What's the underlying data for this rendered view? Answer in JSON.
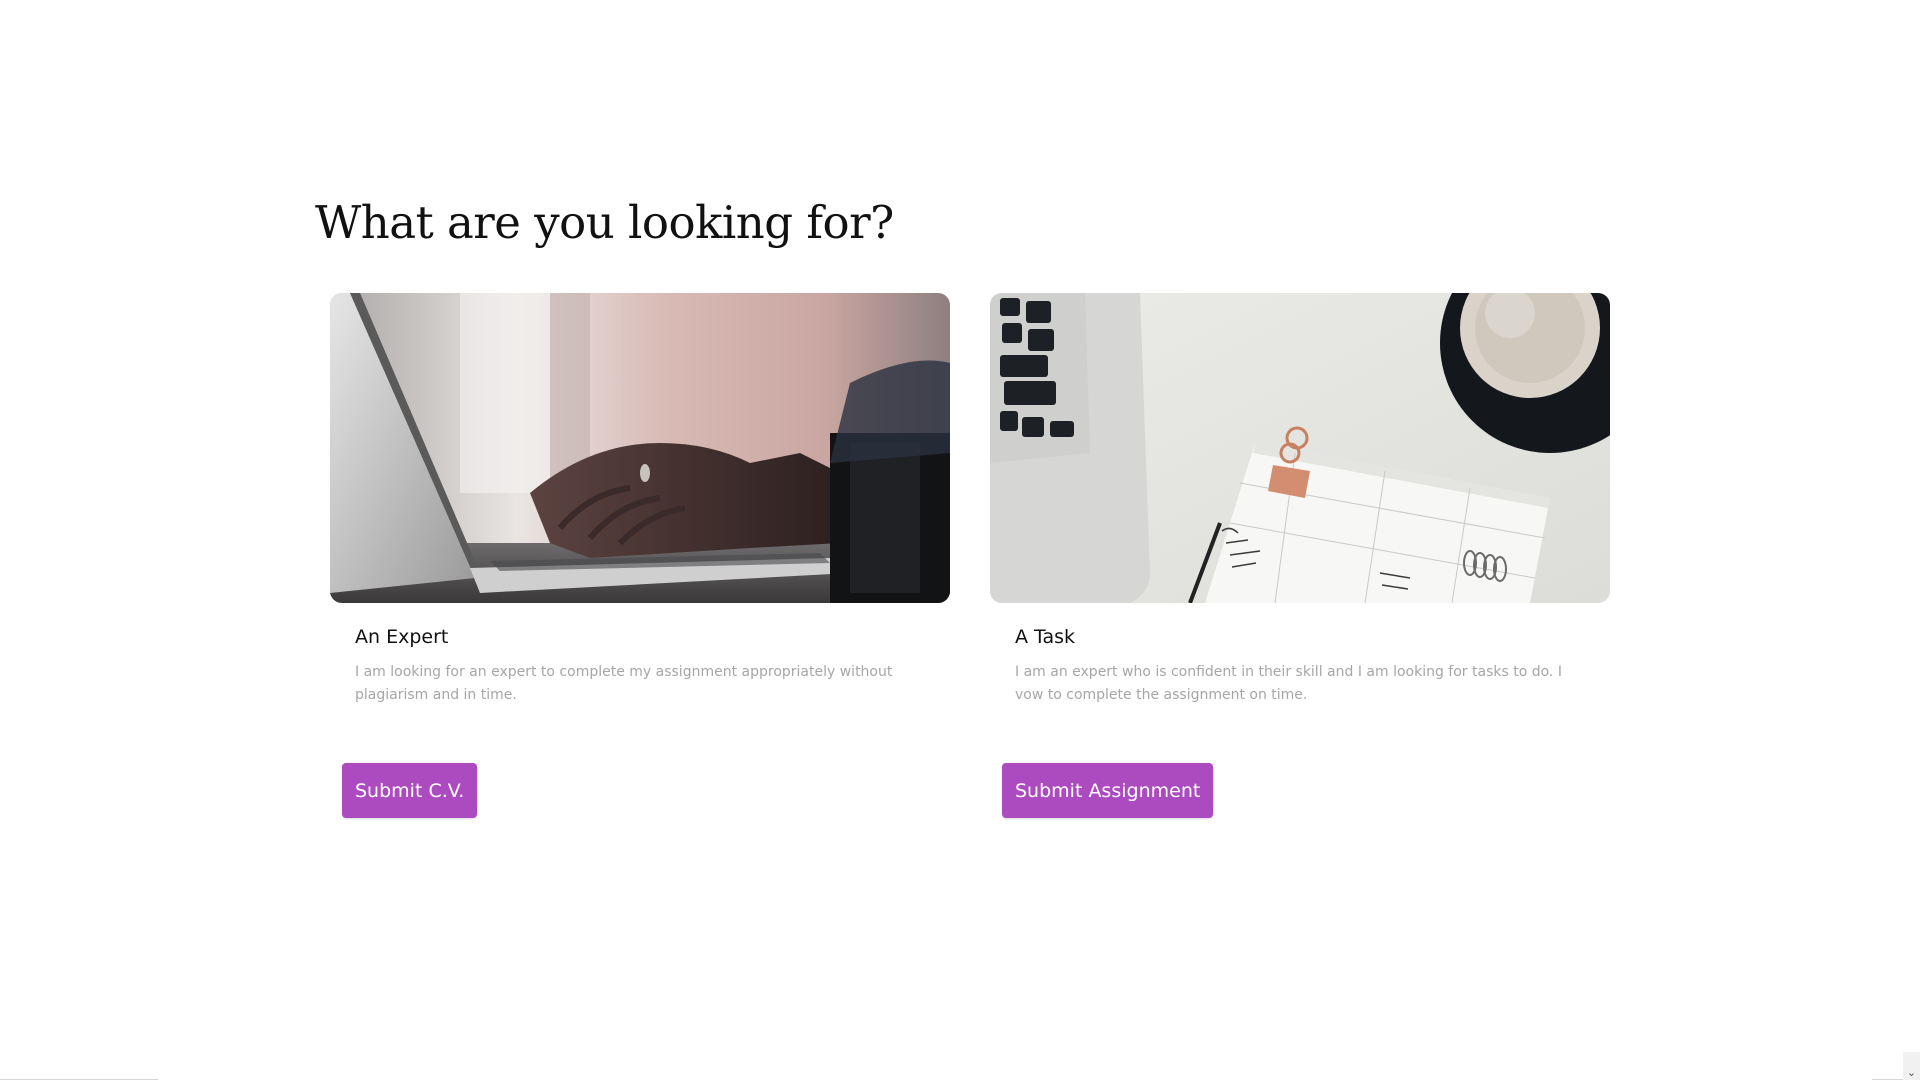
{
  "heading": "What are you looking for?",
  "cards": [
    {
      "image_desc": "laptop-typing-photo",
      "title": "An Expert",
      "description": "I am looking for an expert to complete my assignment appropriately without plagiarism and in time.",
      "button_label": "Submit C.V."
    },
    {
      "image_desc": "desk-planner-photo",
      "title": "A Task",
      "description": "I am an expert who is confident in their skill and I am looking for tasks to do. I vow to complete the assignment on time.",
      "button_label": "Submit Assignment"
    }
  ],
  "colors": {
    "button": "#ab4bbf",
    "heading": "#111111",
    "description": "#a6a6a6"
  },
  "scrollbar": {
    "arrow_icon": "chevron-down-icon"
  }
}
